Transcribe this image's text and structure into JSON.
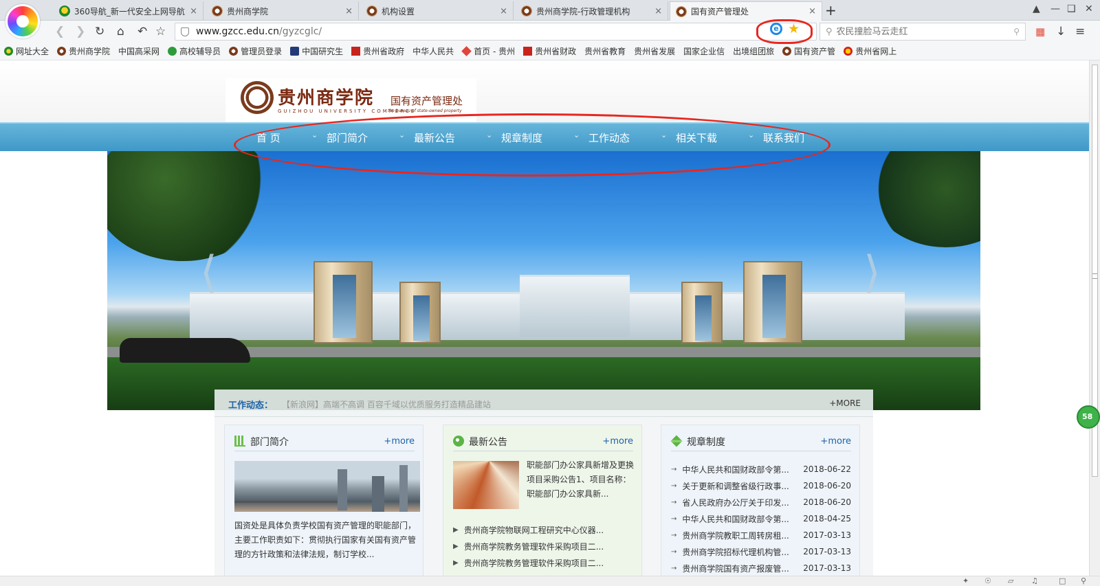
{
  "tabs": [
    {
      "title": "360导航_新一代安全上网导航",
      "icon": "nav-globe-icon"
    },
    {
      "title": "贵州商学院",
      "icon": "school-seal-icon"
    },
    {
      "title": "机构设置",
      "icon": "school-seal-icon"
    },
    {
      "title": "贵州商学院-行政管理机构",
      "icon": "school-seal-icon"
    },
    {
      "title": "国有资产管理处",
      "icon": "school-seal-icon",
      "active": true
    }
  ],
  "tab_close": "×",
  "new_tab": "+",
  "toolbar": {
    "url_host": "www.gzcc.edu.cn",
    "url_path": "/gyzcglc/",
    "search_placeholder": "农民撞脸马云走红"
  },
  "bookmarks": [
    {
      "label": "网址大全",
      "icon": "globe"
    },
    {
      "label": "贵州商学院",
      "icon": "seal"
    },
    {
      "label": "中国高采网",
      "icon": "page"
    },
    {
      "label": "高校辅导员",
      "icon": "green"
    },
    {
      "label": "管理员登录",
      "icon": "seal"
    },
    {
      "label": "中国研究生",
      "icon": "cap"
    },
    {
      "label": "贵州省政府",
      "icon": "red"
    },
    {
      "label": "中华人民共",
      "icon": "page"
    },
    {
      "label": "首页 - 贵州",
      "icon": "diamond"
    },
    {
      "label": "贵州省财政",
      "icon": "red"
    },
    {
      "label": "贵州省教育",
      "icon": "page"
    },
    {
      "label": "贵州省发展",
      "icon": "page"
    },
    {
      "label": "国家企业信",
      "icon": "page"
    },
    {
      "label": "出境组团旅",
      "icon": "page"
    },
    {
      "label": "国有资产管",
      "icon": "seal"
    },
    {
      "label": "贵州省网上",
      "icon": "emblem"
    }
  ],
  "site": {
    "logo_cn": "贵州商学院",
    "logo_en": "GUIZHOU UNIVERSITY COMMERCE",
    "dept_cn": "国有资产管理处",
    "dept_en": "the bureau of state-owned property"
  },
  "nav": [
    "首 页",
    "部门简介",
    "最新公告",
    "规章制度",
    "工作动态",
    "相关下载",
    "联系我们"
  ],
  "ticker": {
    "label": "工作动态：",
    "message": "【新浪网】高端不高调 百容千域以优质服务打造精品建站",
    "more": "+MORE"
  },
  "panels": {
    "dept": {
      "title": "部门简介",
      "more": "+more",
      "text": "国资处是具体负责学校国有资产管理的职能部门，主要工作职责如下：贯彻执行国家有关国有资产管理的方针政策和法律法规，制订学校..."
    },
    "notices": {
      "title": "最新公告",
      "more": "+more",
      "featured": "职能部门办公家具新增及更换项目采购公告1、项目名称：职能部门办公家具新...",
      "items": [
        "贵州商学院物联网工程研究中心仪器...",
        "贵州商学院教务管理软件采购项目二...",
        "贵州商学院教务管理软件采购项目二..."
      ]
    },
    "rules": {
      "title": "规章制度",
      "more": "+more",
      "items": [
        {
          "title": "中华人民共和国财政部令第...",
          "date": "2018-06-22"
        },
        {
          "title": "关于更新和调整省级行政事...",
          "date": "2018-06-20"
        },
        {
          "title": "省人民政府办公厅关于印发...",
          "date": "2018-06-20"
        },
        {
          "title": "中华人民共和国财政部令第...",
          "date": "2018-04-25"
        },
        {
          "title": "贵州商学院教职工周转房租...",
          "date": "2017-03-13"
        },
        {
          "title": "贵州商学院招标代理机构管...",
          "date": "2017-03-13"
        },
        {
          "title": "贵州商学院国有资产报废管...",
          "date": "2017-03-13"
        }
      ]
    }
  },
  "float_badge": "58",
  "colors": {
    "nav_bar": "#4fa6d2",
    "annotation": "#e8261f",
    "link": "#1c62a8"
  }
}
